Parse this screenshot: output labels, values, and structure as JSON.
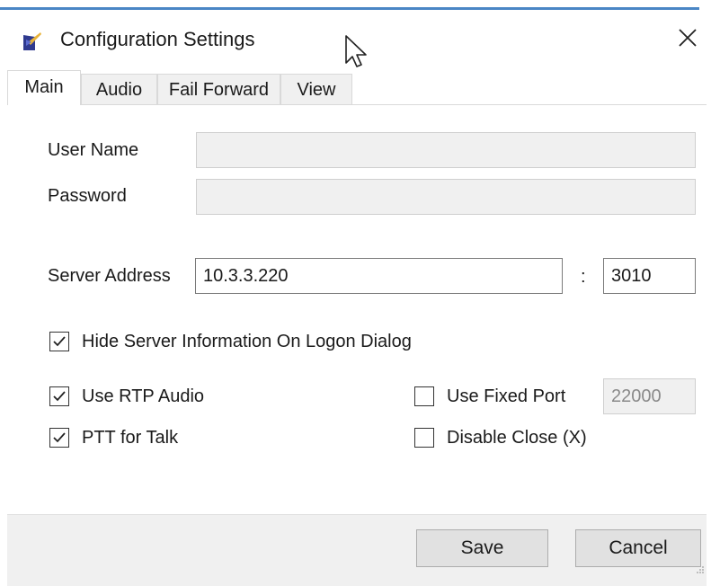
{
  "window": {
    "title": "Configuration Settings",
    "close_glyph": "✕"
  },
  "tabs": [
    {
      "label": "Main",
      "active": true
    },
    {
      "label": "Audio",
      "active": false
    },
    {
      "label": "Fail Forward",
      "active": false
    },
    {
      "label": "View",
      "active": false
    }
  ],
  "main": {
    "user_name": {
      "label": "User Name",
      "value": ""
    },
    "password": {
      "label": "Password",
      "value": ""
    },
    "server_address": {
      "label": "Server Address",
      "value": "10.3.3.220",
      "separator": ":",
      "port": "3010"
    },
    "hide_server_info": {
      "label": "Hide Server Information On Logon Dialog",
      "checked": true
    },
    "use_rtp_audio": {
      "label": "Use RTP Audio",
      "checked": true
    },
    "ptt_for_talk": {
      "label": "PTT for Talk",
      "checked": true
    },
    "use_fixed_port": {
      "label": "Use Fixed Port",
      "checked": false,
      "port_value": "22000"
    },
    "disable_close": {
      "label": "Disable Close (X)",
      "checked": false
    }
  },
  "footer": {
    "save_label": "Save",
    "cancel_label": "Cancel"
  },
  "colors": {
    "accent_border": "#4a86c5",
    "tab_background": "#f0f0f0",
    "footer_background": "#f0f0f0"
  },
  "icons": {
    "app": "app-logo-icon",
    "close": "close-icon",
    "checkbox_checked": "checkmark-icon",
    "cursor": "mouse-pointer-icon"
  }
}
